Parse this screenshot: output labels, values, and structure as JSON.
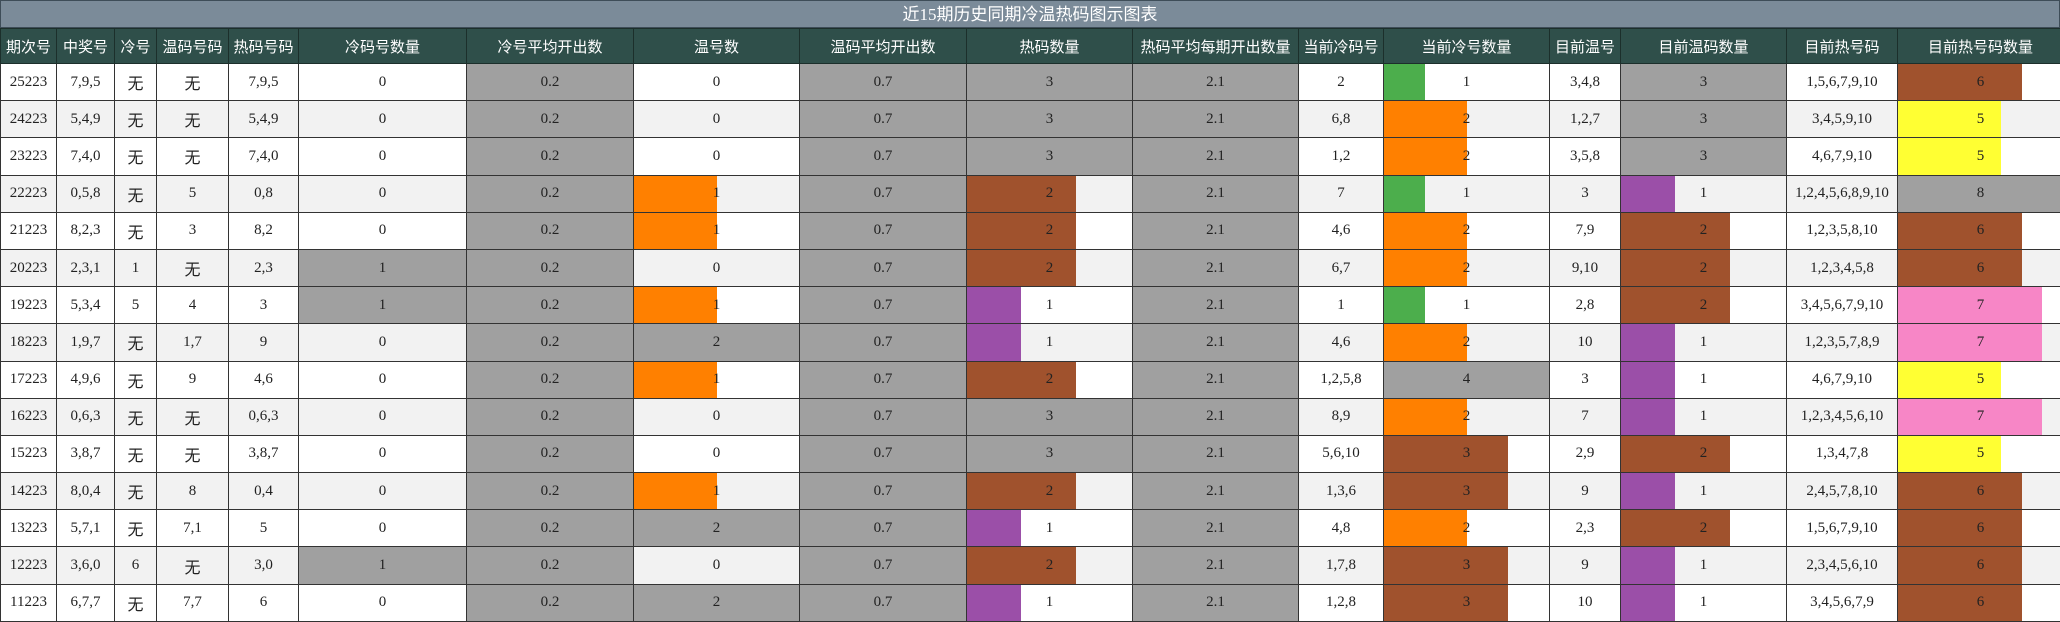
{
  "title": "近15期历史同期冷温热码图示图表",
  "headers": [
    "期次号",
    "中奖号",
    "冷号",
    "温码号码",
    "热码号码",
    "冷码号数量",
    "冷号平均开出数",
    "温号数",
    "温码平均开出数",
    "热码数量",
    "热码平均每期开出数量",
    "当前冷码号",
    "当前冷号数量",
    "目前温号",
    "目前温码数量",
    "目前热号码",
    "目前热号码数量"
  ],
  "colors": {
    "header_bg": "#2f4f4a",
    "title_bg": "#7b8b99",
    "gray": "#a0a0a0",
    "green": "#4cae4c",
    "orange": "#ff8000",
    "brown": "#a0522d",
    "purple": "#9b4fa8",
    "yellow": "#ffff33",
    "pink": "#f786c6"
  },
  "rows": [
    {
      "qc": "25223",
      "zjh": "7,9,5",
      "lh": "无",
      "wmh": "无",
      "rmh": "7,9,5",
      "lmsl": "0",
      "lhpj": "0.2",
      "whs": "0",
      "wmpj": "0.7",
      "rmsl": "3",
      "rmpj": "2.1",
      "dqlm": "2",
      "dqlsl": "1",
      "mqwh": "3,4,8",
      "mqwmsl": "3",
      "mqrh": "1,5,6,7,9,10",
      "mqrhsl": "6"
    },
    {
      "qc": "24223",
      "zjh": "5,4,9",
      "lh": "无",
      "wmh": "无",
      "rmh": "5,4,9",
      "lmsl": "0",
      "lhpj": "0.2",
      "whs": "0",
      "wmpj": "0.7",
      "rmsl": "3",
      "rmpj": "2.1",
      "dqlm": "6,8",
      "dqlsl": "2",
      "mqwh": "1,2,7",
      "mqwmsl": "3",
      "mqrh": "3,4,5,9,10",
      "mqrhsl": "5"
    },
    {
      "qc": "23223",
      "zjh": "7,4,0",
      "lh": "无",
      "wmh": "无",
      "rmh": "7,4,0",
      "lmsl": "0",
      "lhpj": "0.2",
      "whs": "0",
      "wmpj": "0.7",
      "rmsl": "3",
      "rmpj": "2.1",
      "dqlm": "1,2",
      "dqlsl": "2",
      "mqwh": "3,5,8",
      "mqwmsl": "3",
      "mqrh": "4,6,7,9,10",
      "mqrhsl": "5"
    },
    {
      "qc": "22223",
      "zjh": "0,5,8",
      "lh": "无",
      "wmh": "5",
      "rmh": "0,8",
      "lmsl": "0",
      "lhpj": "0.2",
      "whs": "1",
      "wmpj": "0.7",
      "rmsl": "2",
      "rmpj": "2.1",
      "dqlm": "7",
      "dqlsl": "1",
      "mqwh": "3",
      "mqwmsl": "1",
      "mqrh": "1,2,4,5,6,8,9,10",
      "mqrhsl": "8"
    },
    {
      "qc": "21223",
      "zjh": "8,2,3",
      "lh": "无",
      "wmh": "3",
      "rmh": "8,2",
      "lmsl": "0",
      "lhpj": "0.2",
      "whs": "1",
      "wmpj": "0.7",
      "rmsl": "2",
      "rmpj": "2.1",
      "dqlm": "4,6",
      "dqlsl": "2",
      "mqwh": "7,9",
      "mqwmsl": "2",
      "mqrh": "1,2,3,5,8,10",
      "mqrhsl": "6"
    },
    {
      "qc": "20223",
      "zjh": "2,3,1",
      "lh": "1",
      "wmh": "无",
      "rmh": "2,3",
      "lmsl": "1",
      "lhpj": "0.2",
      "whs": "0",
      "wmpj": "0.7",
      "rmsl": "2",
      "rmpj": "2.1",
      "dqlm": "6,7",
      "dqlsl": "2",
      "mqwh": "9,10",
      "mqwmsl": "2",
      "mqrh": "1,2,3,4,5,8",
      "mqrhsl": "6"
    },
    {
      "qc": "19223",
      "zjh": "5,3,4",
      "lh": "5",
      "wmh": "4",
      "rmh": "3",
      "lmsl": "1",
      "lhpj": "0.2",
      "whs": "1",
      "wmpj": "0.7",
      "rmsl": "1",
      "rmpj": "2.1",
      "dqlm": "1",
      "dqlsl": "1",
      "mqwh": "2,8",
      "mqwmsl": "2",
      "mqrh": "3,4,5,6,7,9,10",
      "mqrhsl": "7"
    },
    {
      "qc": "18223",
      "zjh": "1,9,7",
      "lh": "无",
      "wmh": "1,7",
      "rmh": "9",
      "lmsl": "0",
      "lhpj": "0.2",
      "whs": "2",
      "wmpj": "0.7",
      "rmsl": "1",
      "rmpj": "2.1",
      "dqlm": "4,6",
      "dqlsl": "2",
      "mqwh": "10",
      "mqwmsl": "1",
      "mqrh": "1,2,3,5,7,8,9",
      "mqrhsl": "7"
    },
    {
      "qc": "17223",
      "zjh": "4,9,6",
      "lh": "无",
      "wmh": "9",
      "rmh": "4,6",
      "lmsl": "0",
      "lhpj": "0.2",
      "whs": "1",
      "wmpj": "0.7",
      "rmsl": "2",
      "rmpj": "2.1",
      "dqlm": "1,2,5,8",
      "dqlsl": "4",
      "mqwh": "3",
      "mqwmsl": "1",
      "mqrh": "4,6,7,9,10",
      "mqrhsl": "5"
    },
    {
      "qc": "16223",
      "zjh": "0,6,3",
      "lh": "无",
      "wmh": "无",
      "rmh": "0,6,3",
      "lmsl": "0",
      "lhpj": "0.2",
      "whs": "0",
      "wmpj": "0.7",
      "rmsl": "3",
      "rmpj": "2.1",
      "dqlm": "8,9",
      "dqlsl": "2",
      "mqwh": "7",
      "mqwmsl": "1",
      "mqrh": "1,2,3,4,5,6,10",
      "mqrhsl": "7"
    },
    {
      "qc": "15223",
      "zjh": "3,8,7",
      "lh": "无",
      "wmh": "无",
      "rmh": "3,8,7",
      "lmsl": "0",
      "lhpj": "0.2",
      "whs": "0",
      "wmpj": "0.7",
      "rmsl": "3",
      "rmpj": "2.1",
      "dqlm": "5,6,10",
      "dqlsl": "3",
      "mqwh": "2,9",
      "mqwmsl": "2",
      "mqrh": "1,3,4,7,8",
      "mqrhsl": "5"
    },
    {
      "qc": "14223",
      "zjh": "8,0,4",
      "lh": "无",
      "wmh": "8",
      "rmh": "0,4",
      "lmsl": "0",
      "lhpj": "0.2",
      "whs": "1",
      "wmpj": "0.7",
      "rmsl": "2",
      "rmpj": "2.1",
      "dqlm": "1,3,6",
      "dqlsl": "3",
      "mqwh": "9",
      "mqwmsl": "1",
      "mqrh": "2,4,5,7,8,10",
      "mqrhsl": "6"
    },
    {
      "qc": "13223",
      "zjh": "5,7,1",
      "lh": "无",
      "wmh": "7,1",
      "rmh": "5",
      "lmsl": "0",
      "lhpj": "0.2",
      "whs": "2",
      "wmpj": "0.7",
      "rmsl": "1",
      "rmpj": "2.1",
      "dqlm": "4,8",
      "dqlsl": "2",
      "mqwh": "2,3",
      "mqwmsl": "2",
      "mqrh": "1,5,6,7,9,10",
      "mqrhsl": "6"
    },
    {
      "qc": "12223",
      "zjh": "3,6,0",
      "lh": "6",
      "wmh": "无",
      "rmh": "3,0",
      "lmsl": "1",
      "lhpj": "0.2",
      "whs": "0",
      "wmpj": "0.7",
      "rmsl": "2",
      "rmpj": "2.1",
      "dqlm": "1,7,8",
      "dqlsl": "3",
      "mqwh": "9",
      "mqwmsl": "1",
      "mqrh": "2,3,4,5,6,10",
      "mqrhsl": "6"
    },
    {
      "qc": "11223",
      "zjh": "6,7,7",
      "lh": "无",
      "wmh": "7,7",
      "rmh": "6",
      "lmsl": "0",
      "lhpj": "0.2",
      "whs": "2",
      "wmpj": "0.7",
      "rmsl": "1",
      "rmpj": "2.1",
      "dqlm": "1,2,8",
      "dqlsl": "3",
      "mqwh": "10",
      "mqwmsl": "1",
      "mqrh": "3,4,5,6,7,9",
      "mqrhsl": "6"
    }
  ]
}
